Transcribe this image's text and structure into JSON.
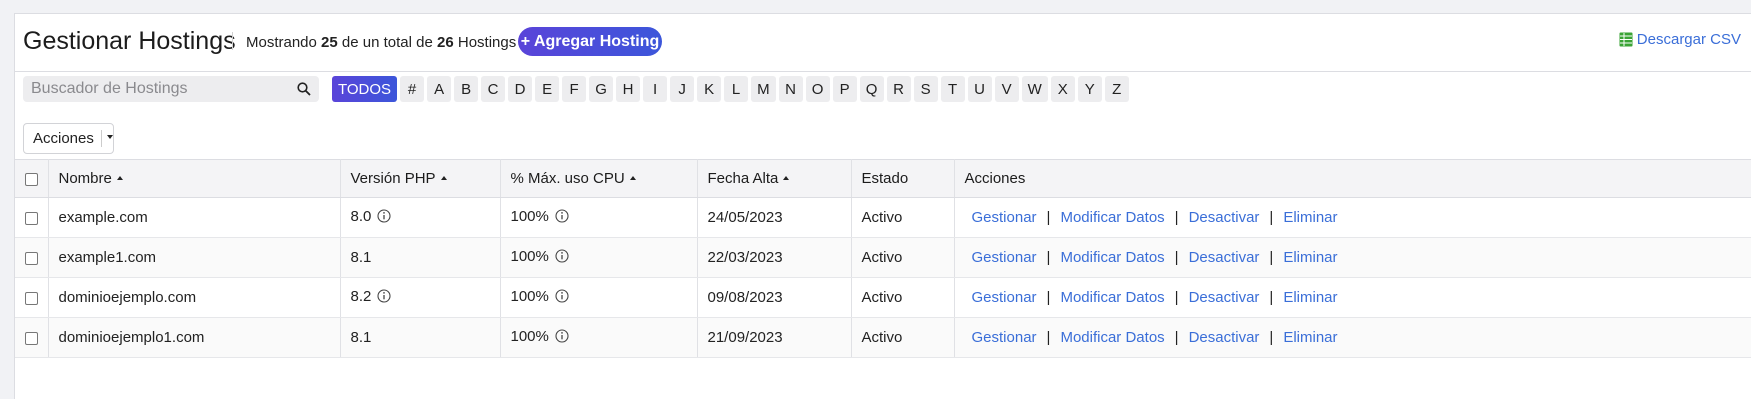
{
  "header": {
    "title": "Gestionar Hostings",
    "summary_prefix": "Mostrando",
    "shown_count": "25",
    "summary_middle": "de un total de",
    "total_count": "26",
    "summary_suffix": "Hostings",
    "add_button": "+ Agregar Hosting",
    "csv_link": "Descargar CSV",
    "csv_icon": "spreadsheet-icon"
  },
  "filter": {
    "search_placeholder": "Buscador de Hostings",
    "search_icon": "search-icon",
    "letters": [
      "TODOS",
      "#",
      "A",
      "B",
      "C",
      "D",
      "E",
      "F",
      "G",
      "H",
      "I",
      "J",
      "K",
      "L",
      "M",
      "N",
      "O",
      "P",
      "Q",
      "R",
      "S",
      "T",
      "U",
      "V",
      "W",
      "X",
      "Y",
      "Z"
    ],
    "active_letter": "TODOS"
  },
  "bulk": {
    "actions_label": "Acciones"
  },
  "table": {
    "columns": [
      "Nombre",
      "Versión PHP",
      "% Máx. uso CPU",
      "Fecha Alta",
      "Estado",
      "Acciones"
    ],
    "rows": [
      {
        "nombre": "example.com",
        "php": "8.0",
        "php_info": true,
        "cpu": "100%",
        "fecha": "24/05/2023",
        "estado": "Activo"
      },
      {
        "nombre": "example1.com",
        "php": "8.1",
        "php_info": false,
        "cpu": "100%",
        "fecha": "22/03/2023",
        "estado": "Activo"
      },
      {
        "nombre": "dominioejemplo.com",
        "php": "8.2",
        "php_info": true,
        "cpu": "100%",
        "fecha": "09/08/2023",
        "estado": "Activo"
      },
      {
        "nombre": "dominioejemplo1.com",
        "php": "8.1",
        "php_info": false,
        "cpu": "100%",
        "fecha": "21/09/2023",
        "estado": "Activo"
      }
    ],
    "row_actions": [
      "Gestionar",
      "Modificar Datos",
      "Desactivar",
      "Eliminar"
    ],
    "action_separator": "|"
  },
  "colors": {
    "accent_start": "#5a44d9",
    "accent_end": "#3c56da",
    "link": "#3a6ed8",
    "csv_icon": "#3aa335"
  }
}
